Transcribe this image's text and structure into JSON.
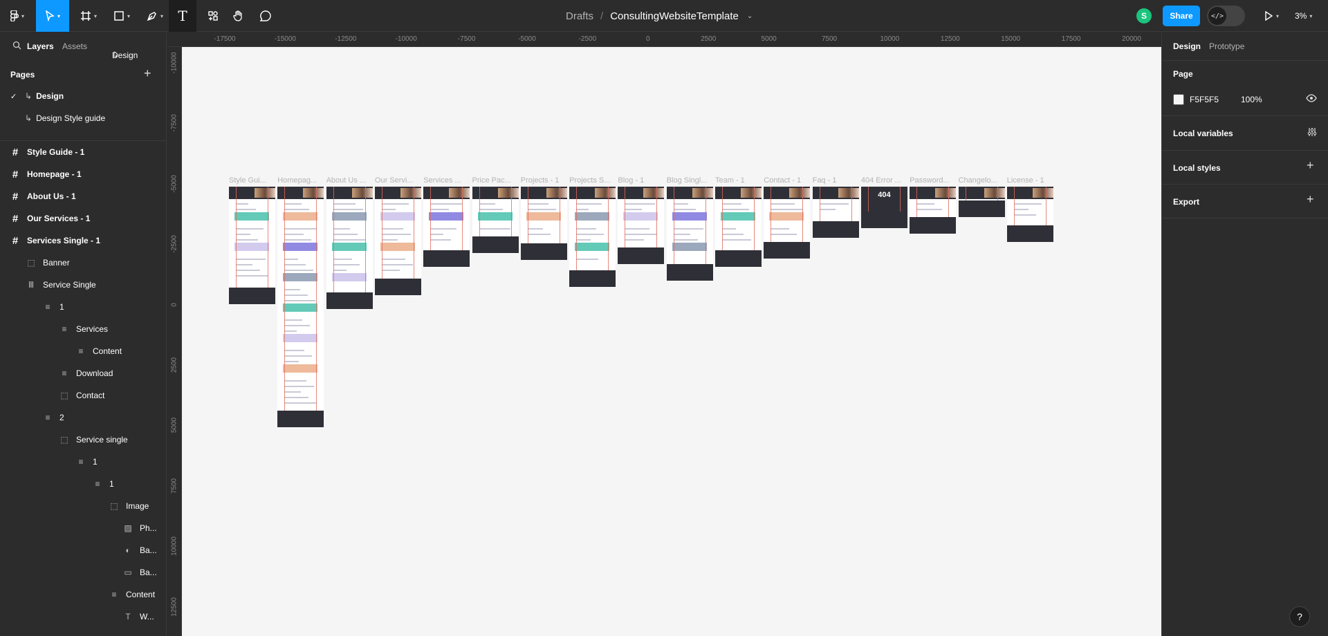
{
  "toolbar": {
    "tools": [
      "main-menu",
      "move",
      "frame",
      "shape",
      "pen",
      "text",
      "resources",
      "hand",
      "comment"
    ],
    "text_tool_glyph": "T"
  },
  "breadcrumb": {
    "project": "Drafts",
    "separator": "/",
    "file": "ConsultingWebsiteTemplate"
  },
  "header": {
    "avatar_initial": "S",
    "share_label": "Share",
    "zoom": "3%",
    "dev_mode_icon": "</>"
  },
  "left_panel": {
    "tabs": {
      "layers": "Layers",
      "assets": "Assets",
      "page_switch": "Design"
    },
    "pages_heading": "Pages",
    "pages": [
      {
        "label": "Design",
        "checked": true
      },
      {
        "label": "Design Style guide",
        "checked": false
      }
    ],
    "layers": [
      {
        "label": "Style Guide - 1",
        "icon": "frame-icon",
        "bold": true
      },
      {
        "label": "Homepage - 1",
        "icon": "frame-icon",
        "bold": true
      },
      {
        "label": "About Us - 1",
        "icon": "frame-icon",
        "bold": true
      },
      {
        "label": "Our Services - 1",
        "icon": "frame-icon",
        "bold": true
      },
      {
        "label": "Services Single - 1",
        "icon": "frame-icon",
        "bold": true
      },
      {
        "label": "Banner",
        "icon": "group-icon"
      },
      {
        "label": "Service Single",
        "icon": "auto-layout-icon"
      },
      {
        "label": "1",
        "icon": "stack-icon"
      },
      {
        "label": "Services",
        "icon": "stack-icon"
      },
      {
        "label": "Content",
        "icon": "stack-icon"
      },
      {
        "label": "Download",
        "icon": "stack-icon"
      },
      {
        "label": "Contact",
        "icon": "group-icon"
      },
      {
        "label": "2",
        "icon": "stack-icon"
      },
      {
        "label": "Service single",
        "icon": "group-icon"
      },
      {
        "label": "1",
        "icon": "stack-icon"
      },
      {
        "label": "1",
        "icon": "stack-icon"
      },
      {
        "label": "Image",
        "icon": "group-icon"
      },
      {
        "label": "Ph...",
        "icon": "image-icon"
      },
      {
        "label": "Ba...",
        "icon": "mask-icon"
      },
      {
        "label": "Ba...",
        "icon": "rectangle-icon"
      },
      {
        "label": "Content",
        "icon": "stack-icon"
      },
      {
        "label": "W...",
        "icon": "text-icon"
      }
    ]
  },
  "ruler": {
    "x_ticks": [
      "-17500",
      "-15000",
      "-12500",
      "-10000",
      "-7500",
      "-5000",
      "-2500",
      "0",
      "2500",
      "5000",
      "7500",
      "10000",
      "12500",
      "15000",
      "17500",
      "20000"
    ],
    "y_ticks": [
      "-10000",
      "-7500",
      "-5000",
      "-2500",
      "0",
      "2500",
      "5000",
      "7500",
      "10000",
      "12500"
    ]
  },
  "canvas": {
    "background": "#F5F5F5",
    "frames": [
      {
        "label": "Style Gui..."
      },
      {
        "label": "Homepag..."
      },
      {
        "label": "About Us ..."
      },
      {
        "label": "Our Servi..."
      },
      {
        "label": "Services ..."
      },
      {
        "label": "Price Pac..."
      },
      {
        "label": "Projects - 1"
      },
      {
        "label": "Projects S..."
      },
      {
        "label": "Blog - 1"
      },
      {
        "label": "Blog Singl..."
      },
      {
        "label": "Team - 1"
      },
      {
        "label": "Contact - 1"
      },
      {
        "label": "Faq - 1"
      },
      {
        "label": "404 Error ...",
        "big_text": "404"
      },
      {
        "label": "Password..."
      },
      {
        "label": "Changelo..."
      },
      {
        "label": "License - 1"
      }
    ]
  },
  "right_panel": {
    "tabs": {
      "design": "Design",
      "prototype": "Prototype"
    },
    "page_heading": "Page",
    "page_color": "F5F5F5",
    "page_opacity": "100%",
    "sections": [
      "Local variables",
      "Local styles",
      "Export"
    ]
  },
  "colors": {
    "accent": "#0d99ff",
    "panel": "#2c2c2c",
    "canvas": "#f5f5f5",
    "avatar": "#1bc47d"
  }
}
